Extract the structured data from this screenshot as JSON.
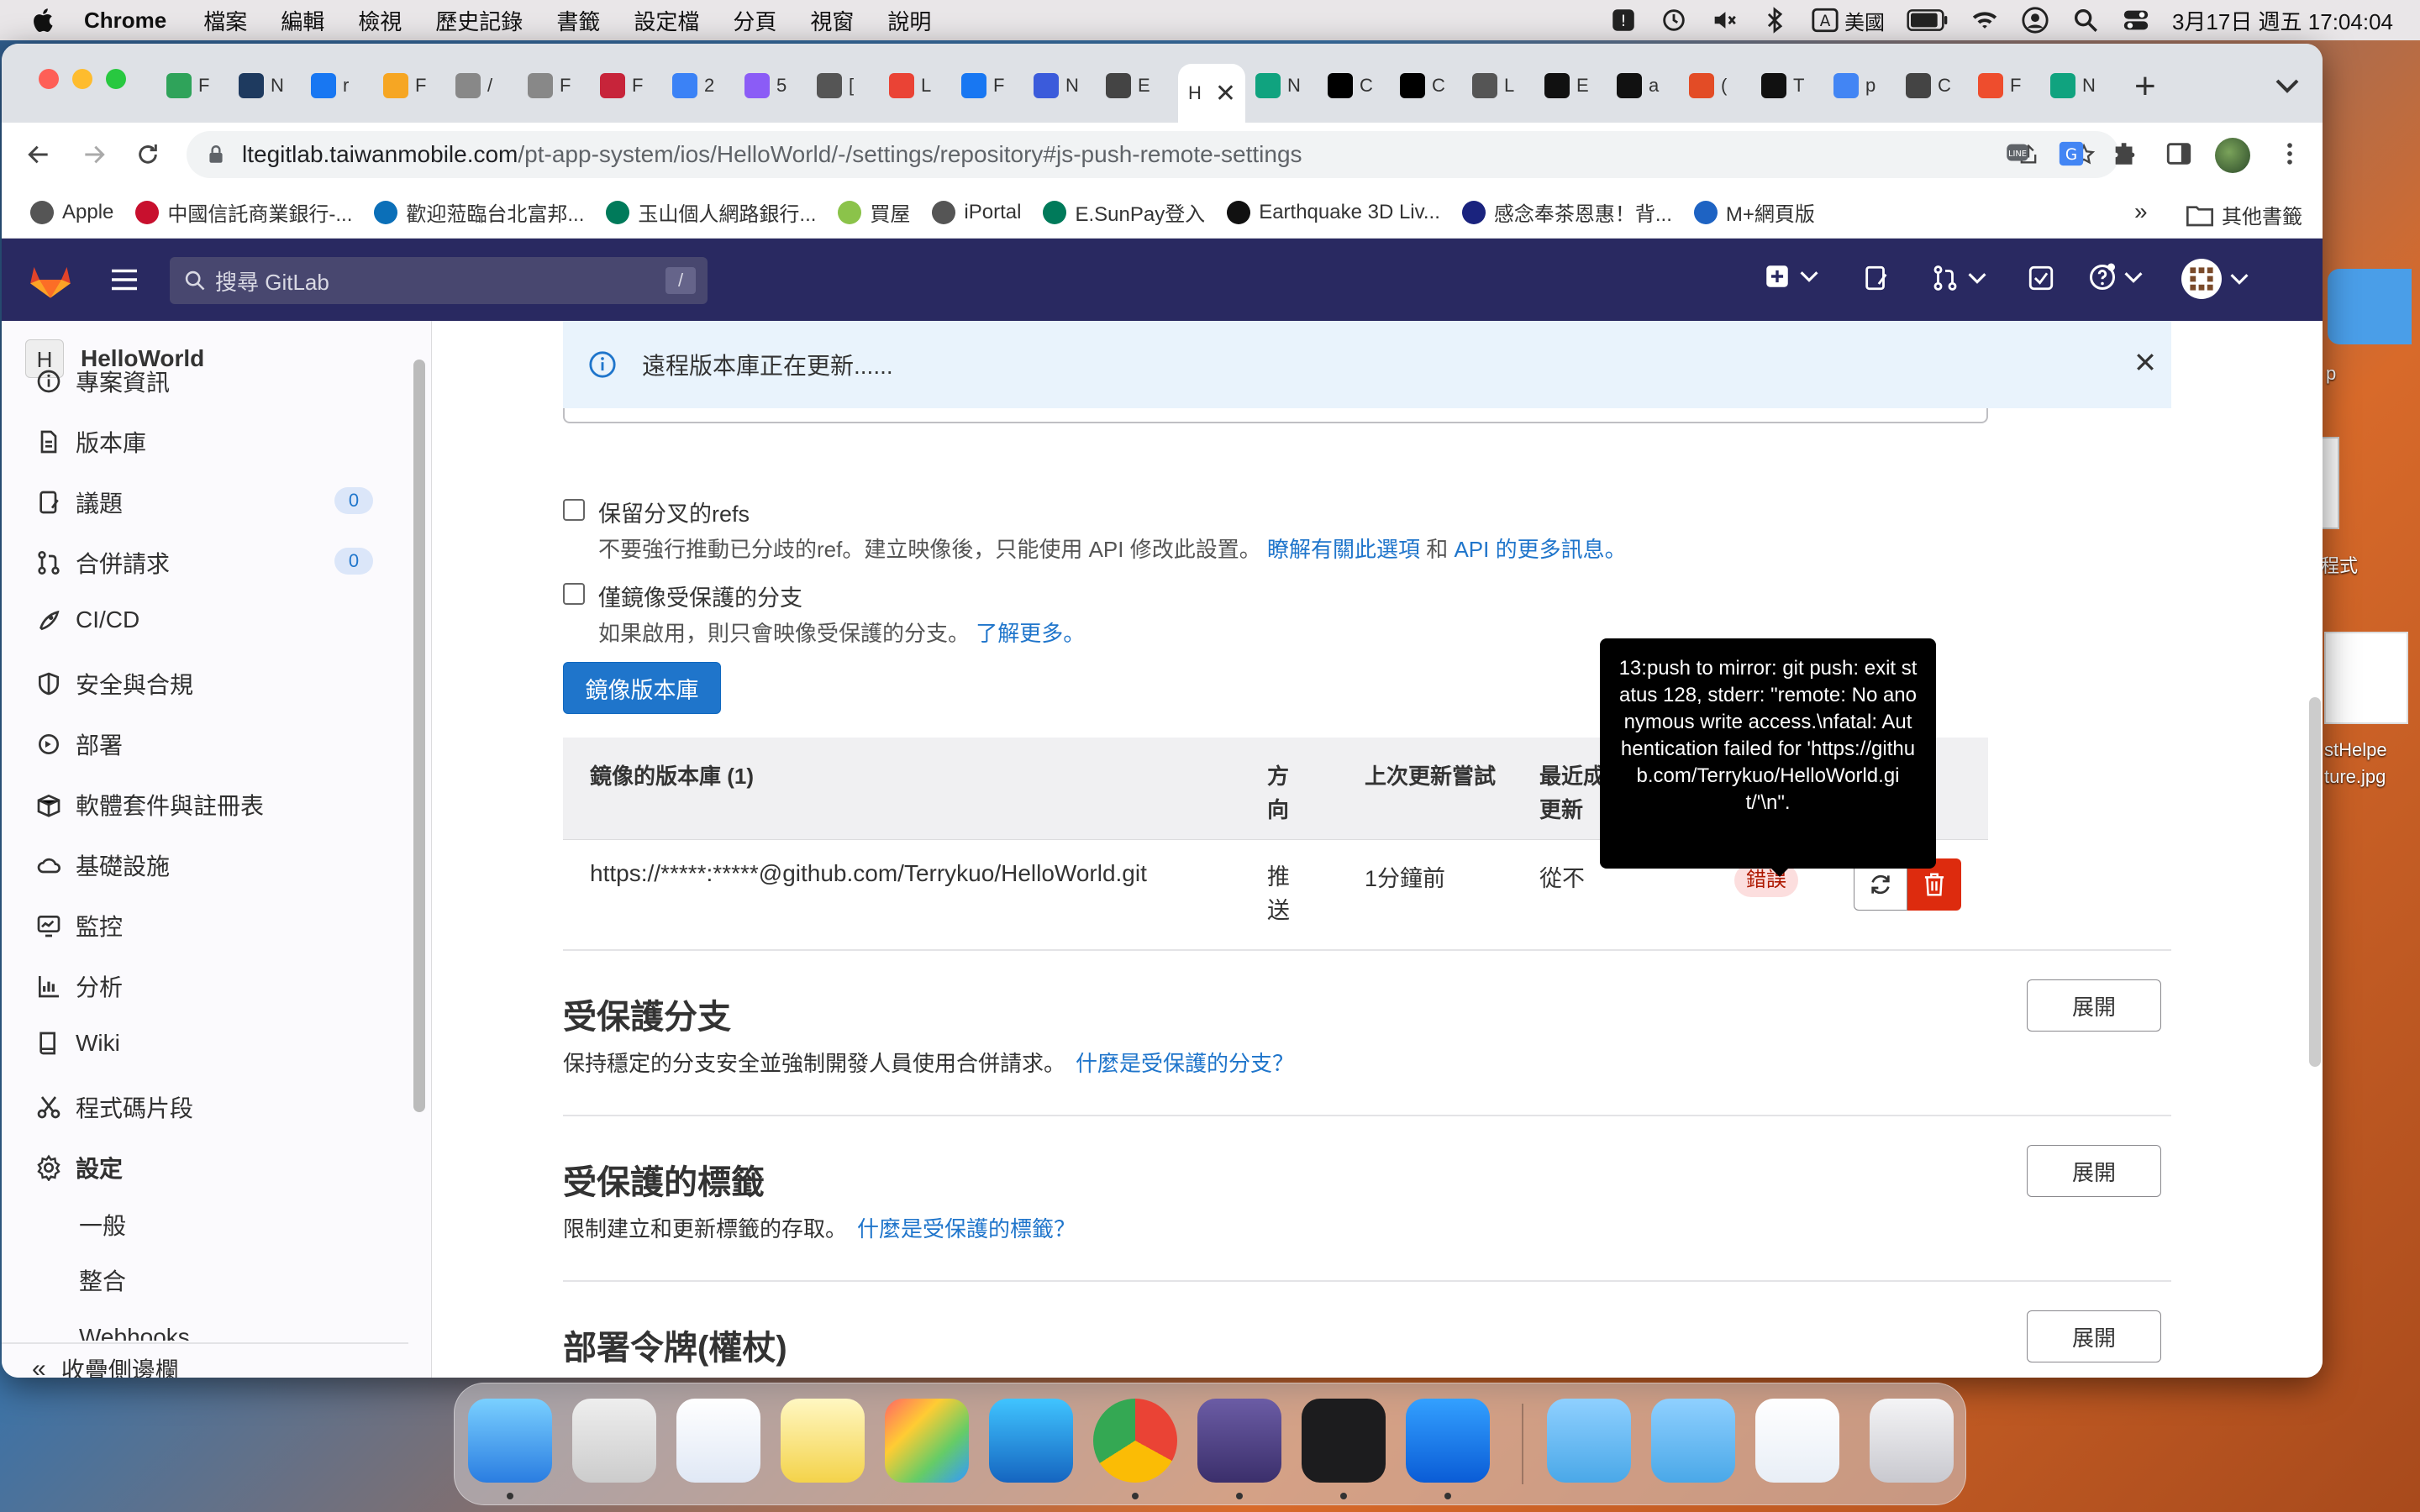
{
  "menubar": {
    "app": "Chrome",
    "items": [
      "檔案",
      "編輯",
      "檢視",
      "歷史記錄",
      "書籤",
      "設定檔",
      "分頁",
      "視窗",
      "說明"
    ],
    "input_method": "美國",
    "datetime": "3月17日 週五 17:04:04"
  },
  "desktop": {
    "file1": "p",
    "file2": "程式",
    "file3_line1": "stHelpe",
    "file3_line2": "ture.jpg"
  },
  "browser": {
    "tabs": [
      {
        "letter": "F",
        "color": "#2fa35a"
      },
      {
        "letter": "N",
        "color": "#1e3a5f"
      },
      {
        "letter": "r",
        "color": "#1877f2"
      },
      {
        "letter": "F",
        "color": "#f6a623"
      },
      {
        "letter": "/",
        "color": "#888"
      },
      {
        "letter": "F",
        "color": "#888"
      },
      {
        "letter": "F",
        "color": "#c7243a"
      },
      {
        "letter": "2",
        "color": "#3b82f6"
      },
      {
        "letter": "5",
        "color": "#8b5cf6"
      },
      {
        "letter": "[",
        "color": "#555"
      },
      {
        "letter": "L",
        "color": "#ea4335"
      },
      {
        "letter": "F",
        "color": "#1877f2"
      },
      {
        "letter": "N",
        "color": "#3b5bdb"
      },
      {
        "letter": "E",
        "color": "#444"
      }
    ],
    "active_tab_title": "H",
    "tabs_right": [
      {
        "letter": "N",
        "color": "#10a37f"
      },
      {
        "letter": "C",
        "color": "#000"
      },
      {
        "letter": "C",
        "color": "#000"
      },
      {
        "letter": "L",
        "color": "#555"
      },
      {
        "letter": "E",
        "color": "#111"
      },
      {
        "letter": "a",
        "color": "#111"
      },
      {
        "letter": "(",
        "color": "#e34c26"
      },
      {
        "letter": "T",
        "color": "#111"
      },
      {
        "letter": "p",
        "color": "#4285f4"
      },
      {
        "letter": "C",
        "color": "#444"
      },
      {
        "letter": "F",
        "color": "#ee4d2d"
      },
      {
        "letter": "N",
        "color": "#10a37f"
      }
    ],
    "url_host": "ltegitlab.taiwanmobile.com",
    "url_path": "/pt-app-system/ios/HelloWorld/-/settings/repository#js-push-remote-settings",
    "bookmarks": [
      {
        "label": "Apple",
        "color": "#555"
      },
      {
        "label": "中國信託商業銀行-...",
        "color": "#c8102e"
      },
      {
        "label": "歡迎蒞臨台北富邦...",
        "color": "#0b6fb8"
      },
      {
        "label": "玉山個人網路銀行...",
        "color": "#007a5a"
      },
      {
        "label": "買屋",
        "color": "#8bc34a"
      },
      {
        "label": "iPortal",
        "color": "#555"
      },
      {
        "label": "E.SunPay登入",
        "color": "#007a5a"
      },
      {
        "label": "Earthquake 3D Liv...",
        "color": "#111"
      },
      {
        "label": "感念奉茶恩惠！背...",
        "color": "#1a237e"
      },
      {
        "label": "M+網頁版",
        "color": "#1e63c3"
      }
    ],
    "bookmarks_more": "»",
    "other_bookmarks": "其他書籤"
  },
  "gitlab": {
    "search_placeholder": "搜尋 GitLab",
    "search_shortcut": "/",
    "project_initial": "H",
    "project_name": "HelloWorld",
    "sidebar": [
      {
        "label": "專案資訊",
        "icon": "info-icon"
      },
      {
        "label": "版本庫",
        "icon": "document-icon"
      },
      {
        "label": "議題",
        "icon": "issues-icon",
        "badge": "0"
      },
      {
        "label": "合併請求",
        "icon": "merge-request-icon",
        "badge": "0"
      },
      {
        "label": "CI/CD",
        "icon": "rocket-icon"
      },
      {
        "label": "安全與合規",
        "icon": "shield-icon"
      },
      {
        "label": "部署",
        "icon": "deployments-icon"
      },
      {
        "label": "軟體套件與註冊表",
        "icon": "package-icon"
      },
      {
        "label": "基礎設施",
        "icon": "cloud-icon"
      },
      {
        "label": "監控",
        "icon": "monitor-icon"
      },
      {
        "label": "分析",
        "icon": "chart-icon"
      },
      {
        "label": "Wiki",
        "icon": "book-icon"
      },
      {
        "label": "程式碼片段",
        "icon": "snippet-icon"
      },
      {
        "label": "設定",
        "icon": "settings-icon"
      }
    ],
    "settings_sub": [
      "一般",
      "整合",
      "Webhooks"
    ],
    "collapse_sidebar": "收疊側邊欄",
    "alert": "遠程版本庫正在更新......",
    "keep_divergent": {
      "label": "保留分叉的refs",
      "help": "不要強行推動已分歧的ref。建立映像後，只能使用 API 修改此設置。",
      "link1": "瞭解有關此選項",
      "and": "和",
      "link2": "API 的更多訊息。"
    },
    "protected_only": {
      "label": "僅鏡像受保護的分支",
      "help": "如果啟用，則只會映像受保護的分支。",
      "link": "了解更多。"
    },
    "mirror_button": "鏡像版本庫",
    "table": {
      "col_repo": "鏡像的版本庫 (1)",
      "col_direction": "方向",
      "col_last_attempt": "上次更新嘗試",
      "col_last_success": "最近成功更新",
      "row": {
        "url": "https://*****:*****@github.com/Terrykuo/HelloWorld.git",
        "direction": "推送",
        "last_attempt": "1分鐘前",
        "last_success": "從不",
        "status": "錯誤"
      }
    },
    "tooltip": "13:push to mirror: git push: exit status 128, stderr: \"remote: No anonymous write access.\\nfatal: Authentication failed for 'https://github.com/Terrykuo/HelloWorld.git/'\\n\".",
    "sections": [
      {
        "title": "受保護分支",
        "desc": "保持穩定的分支安全並強制開發人員使用合併請求。",
        "link": "什麼是受保護的分支？",
        "button": "展開"
      },
      {
        "title": "受保護的標籤",
        "desc": "限制建立和更新標籤的存取。",
        "link": "什麼是受保護的標籤？",
        "button": "展開"
      },
      {
        "title": "部署令牌(權杖)",
        "desc": "",
        "link": "",
        "button": "展開"
      }
    ]
  },
  "dock": [
    "finder-icon",
    "launchpad-icon",
    "safari-icon",
    "notes-icon",
    "photos-icon",
    "app-store-icon",
    "chrome-icon",
    "bbedit-icon",
    "terminal-icon",
    "find-my-icon",
    "downloads-folder-icon",
    "applications-folder-icon",
    "document-stack-icon",
    "trash-icon"
  ]
}
